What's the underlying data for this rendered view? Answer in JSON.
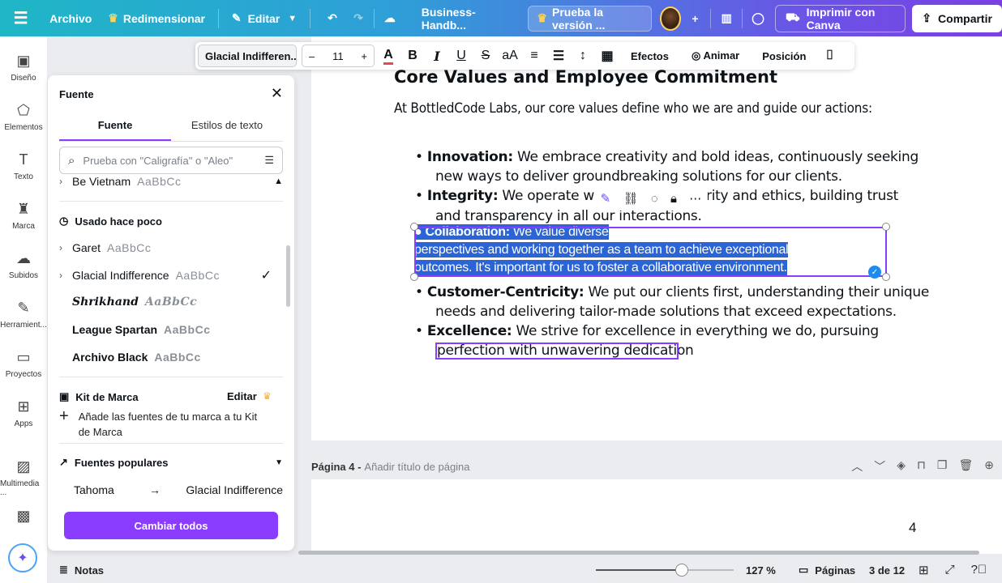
{
  "topbar": {
    "menu_icon": "hamburger-icon",
    "archivo": "Archivo",
    "redimensionar": "Redimensionar",
    "editar": "Editar",
    "doc_title": "Business-Handb...",
    "trial": "Prueba la versión ...",
    "print": "Imprimir con Canva",
    "share": "Compartir",
    "brand_color": "#8b3dff"
  },
  "rail": {
    "items": [
      {
        "label": "Diseño",
        "icon": "layout-icon"
      },
      {
        "label": "Elementos",
        "icon": "shapes-icon"
      },
      {
        "label": "Texto",
        "icon": "text-icon"
      },
      {
        "label": "Marca",
        "icon": "brand-icon"
      },
      {
        "label": "Subidos",
        "icon": "cloud-upload-icon"
      },
      {
        "label": "Herramient...",
        "icon": "tools-icon"
      },
      {
        "label": "Proyectos",
        "icon": "folder-icon"
      },
      {
        "label": "Apps",
        "icon": "apps-icon"
      },
      {
        "label": "Multimedia ...",
        "icon": "media-icon"
      }
    ]
  },
  "panel": {
    "title": "Fuente",
    "tabs": [
      "Fuente",
      "Estilos de texto"
    ],
    "search_placeholder": "Prueba con \"Caligrafía\" o \"Aleo\"",
    "top_font": {
      "name": "Be Vietnam",
      "sample": "AaBbCc"
    },
    "recent_title": "Usado hace poco",
    "recent": [
      {
        "name": "Garet",
        "sample": "AaBbCc"
      },
      {
        "name": "Glacial Indifference",
        "sample": "AaBbCc",
        "selected": true
      },
      {
        "name": "Shrikhand",
        "sample": "AaBbCc"
      },
      {
        "name": "League Spartan",
        "sample": "AaBbCc"
      },
      {
        "name": "Archivo Black",
        "sample": "AaBbCc"
      }
    ],
    "kit_title": "Kit de Marca",
    "kit_edit": "Editar",
    "kit_add": "Añade las fuentes de tu marca a tu Kit de Marca",
    "popular_title": "Fuentes populares",
    "swap_from": "Tahoma",
    "swap_to": "Glacial Indifference",
    "change_all": "Cambiar todos"
  },
  "toolbar": {
    "font": "Glacial Indifferen...",
    "size": "11",
    "effects": "Efectos",
    "animate": "Animar",
    "position": "Posición"
  },
  "doc": {
    "heading": "Core Values and Employee Commitment",
    "intro": "At BottledCode Labs, our core values define who we are and guide our actions:",
    "innovation_label": "Innovation:",
    "innovation_1": " We embrace creativity and bold ideas, continuously seeking",
    "innovation_2": "new ways to deliver groundbreaking solutions for our clients.",
    "integrity_label": "Integrity:",
    "integrity_1a": " We operate with",
    "integrity_1b": "rity and ethics, building trust",
    "integrity_2": "and transparency in all our interactions.",
    "collab_label": "Collaboration:",
    "collab_1": " We value diverse",
    "collab_2": "perspectives and working together as a team to achieve exceptional",
    "collab_3": "outcomes. It's important for us to foster a collaborative environment.",
    "customer_label": "Customer-Centricity:",
    "customer_1": " We put our clients first, understanding their unique",
    "customer_2": "needs and delivering tailor-made solutions that exceed expectations.",
    "excellence_label": "Excellence:",
    "excellence_1": " We strive for excellence in everything we do, pursuing",
    "excellence_2": "perfection with unwavering dedication"
  },
  "pagebar": {
    "label": "Página 4 -",
    "title_placeholder": "Añadir título de página",
    "page_number": "4"
  },
  "bottombar": {
    "notes": "Notas",
    "zoom": "127 %",
    "pages": "Páginas",
    "count": "3 de 12"
  }
}
